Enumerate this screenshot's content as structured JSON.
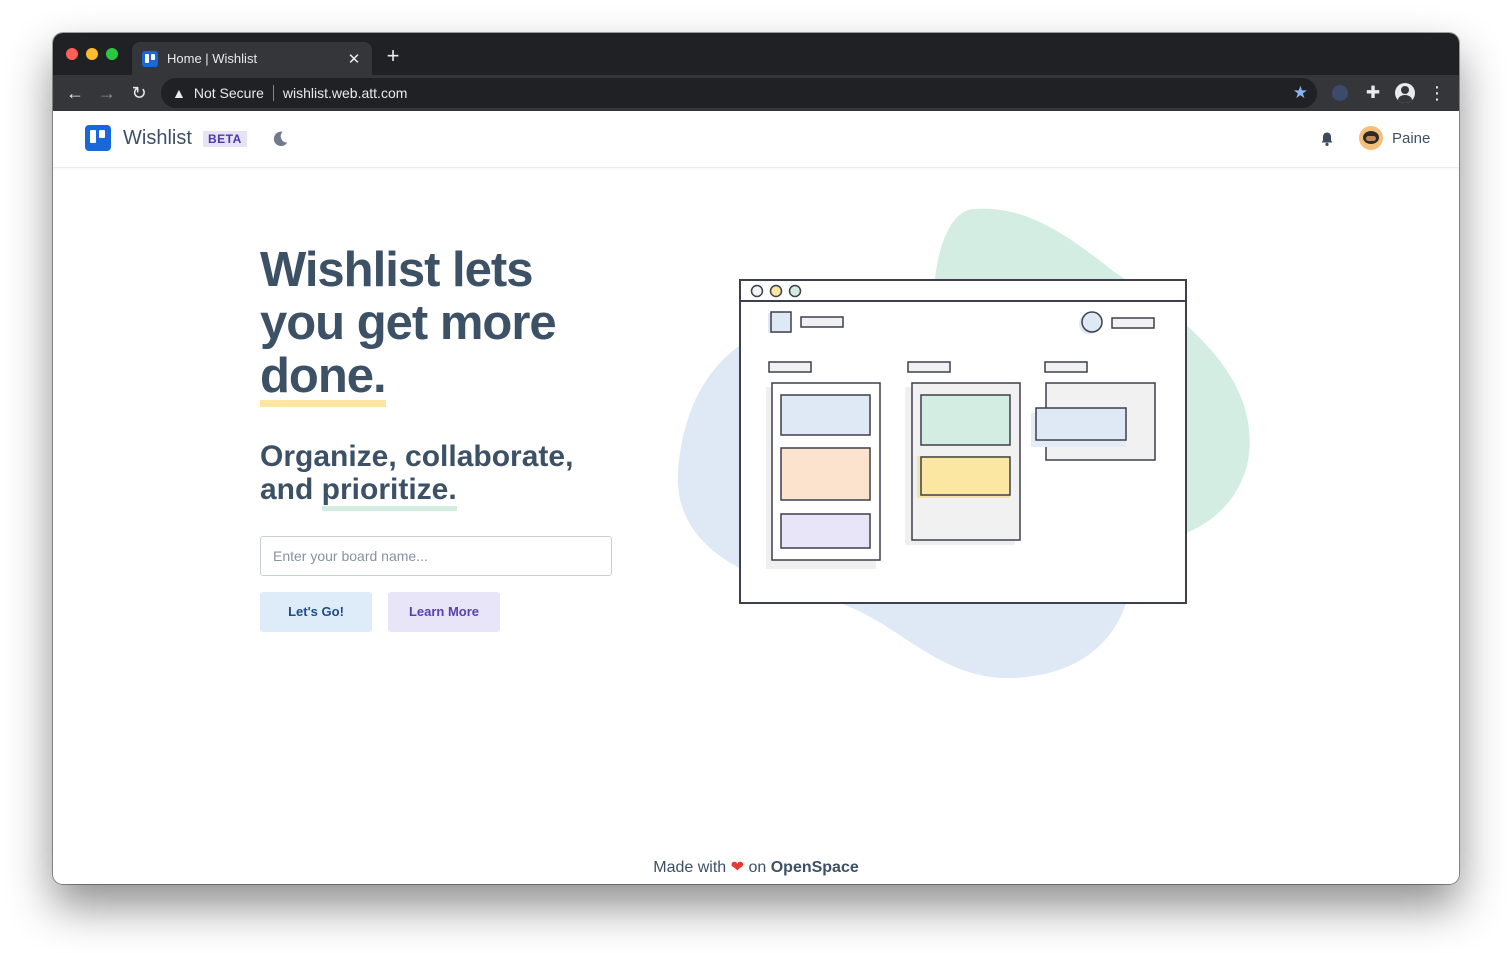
{
  "browser": {
    "tab_title": "Home | Wishlist",
    "tab_close": "✕",
    "new_tab": "+",
    "security_label": "Not Secure",
    "url": "wishlist.web.att.com"
  },
  "app": {
    "brand_name": "Wishlist",
    "beta_badge": "BETA",
    "user_name": "Paine"
  },
  "hero": {
    "title_line1": "Wishlist lets",
    "title_line2": "you get more",
    "title_highlight": "done.",
    "subtitle_prefix": "Organize, collaborate,",
    "subtitle_and": "and ",
    "subtitle_highlight": "prioritize.",
    "input_placeholder": "Enter your board name...",
    "input_value": "",
    "primary_button": "Let's Go!",
    "secondary_button": "Learn More"
  },
  "footer": {
    "prefix": "Made with",
    "heart": "❤",
    "suffix": "on",
    "brand": "OpenSpace"
  },
  "colors": {
    "brand_blue": "#1868db",
    "heading": "#3d5166",
    "highlight_yellow": "#fbe7a1",
    "highlight_green": "#d4ede2",
    "primary_button_bg": "#deebf8",
    "secondary_button_bg": "#e9e5f8"
  }
}
